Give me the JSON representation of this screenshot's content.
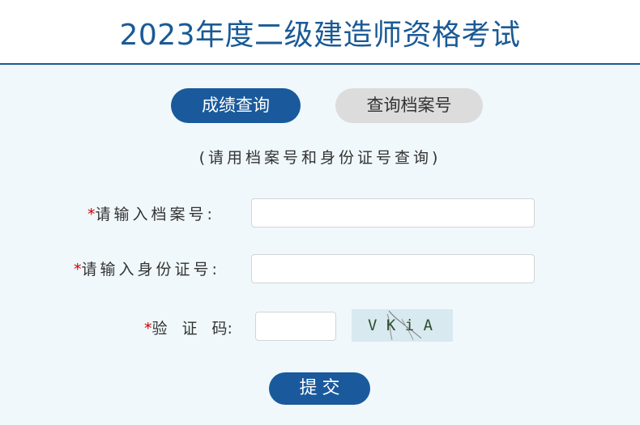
{
  "header": {
    "title": "2023年度二级建造师资格考试"
  },
  "tabs": [
    {
      "label": "成绩查询",
      "active": true
    },
    {
      "label": "查询档案号",
      "active": false
    }
  ],
  "form": {
    "hint": "(请用档案号和身份证号查询)",
    "required_mark": "*",
    "archive_label": "请输入档案号:",
    "archive_value": "",
    "id_label": "请输入身份证号:",
    "id_value": "",
    "captcha_label_parts": [
      "验",
      "证",
      "码:"
    ],
    "captcha_value": "",
    "captcha_text": "V K i A",
    "submit_label": "提交"
  },
  "colors": {
    "brand": "#1a5a9c",
    "background": "#f0f8fc",
    "required": "#cc0000",
    "tab_inactive": "#dcdcdc"
  }
}
